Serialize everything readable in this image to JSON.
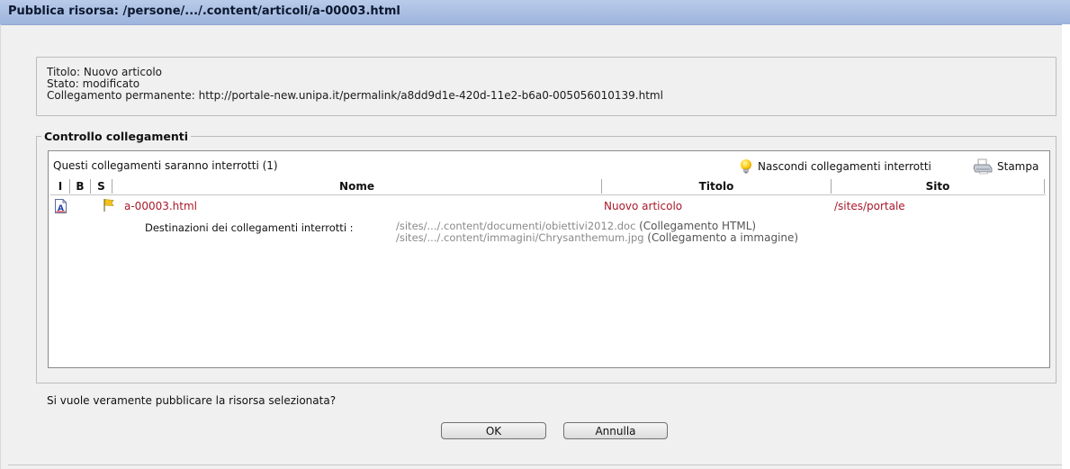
{
  "window": {
    "title": "Pubblica risorsa: /persone/.../.content/articoli/a-00003.html"
  },
  "info": {
    "titolo": "Titolo: Nuovo articolo",
    "stato": "Stato: modificato",
    "permalink": "Collegamento permanente: http://portale-new.unipa.it/permalink/a8dd9d1e-420d-11e2-b6a0-005056010139.html"
  },
  "links_check": {
    "legend": "Controllo collegamenti",
    "caption": "Questi collegamenti saranno interrotti (1)",
    "hide_action": "Nascondi collegamenti interrotti",
    "print_action": "Stampa",
    "columns": [
      "I",
      "B",
      "S",
      "Nome",
      "Titolo",
      "Sito"
    ],
    "rows": [
      {
        "nome": "a-00003.html",
        "titolo": "Nuovo articolo",
        "sito": "/sites/portale",
        "broken_label": "Destinazioni dei collegamenti interrotti :",
        "broken_targets": [
          {
            "path": "/sites/.../.content/documenti/obiettivi2012.doc",
            "kind": "(Collegamento HTML)"
          },
          {
            "path": "/sites/.../.content/immagini/Chrysanthemum.jpg",
            "kind": "(Collegamento a immagine)"
          }
        ]
      }
    ],
    "icons": {
      "hide": "lightbulb-icon",
      "print": "printer-icon",
      "type": "article-icon",
      "state": "flag-icon"
    }
  },
  "footer": {
    "question": "Si vuole veramente pubblicare la risorsa selezionata?",
    "ok_label": "OK",
    "cancel_label": "Annulla"
  },
  "colors": {
    "titlebar": "#9db4dd",
    "link_red": "#a8192a",
    "path_gray": "#8a8a8a"
  }
}
